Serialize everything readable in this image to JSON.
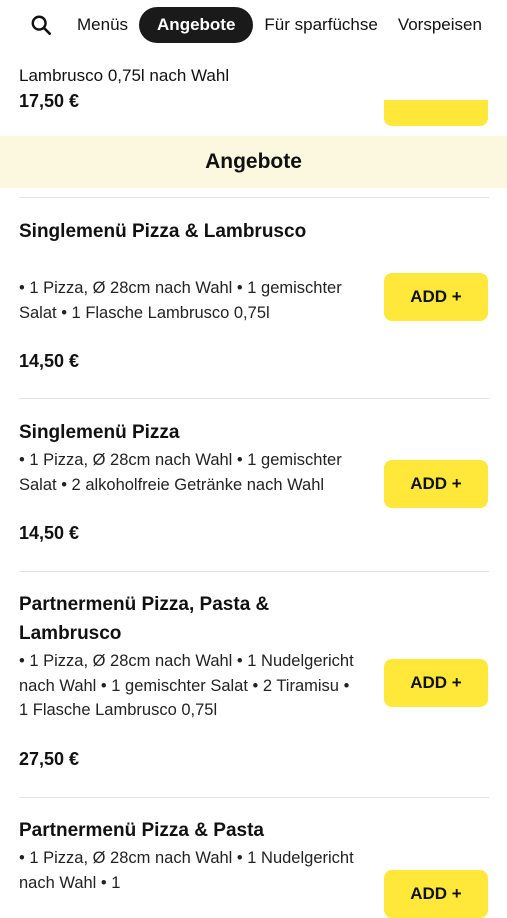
{
  "nav": {
    "tabs": [
      {
        "label": "Menüs",
        "active": false
      },
      {
        "label": "Angebote",
        "active": true
      },
      {
        "label": "Für sparfüchse",
        "active": false
      },
      {
        "label": "Vorspeisen",
        "active": false
      }
    ]
  },
  "previous_item": {
    "description": "Lambrusco 0,75l nach Wahl",
    "price": "17,50 €"
  },
  "section": {
    "title": "Angebote"
  },
  "items": [
    {
      "name": "Singlemenü Pizza & Lambrusco",
      "description": "• 1 Pizza, Ø 28cm nach Wahl • 1 gemischter Salat • 1 Flasche Lambrusco 0,75l",
      "price": "14,50 €",
      "add_label": "ADD +"
    },
    {
      "name": "Singlemenü Pizza",
      "description": "• 1 Pizza, Ø 28cm nach Wahl • 1 gemischter Salat • 2 alkoholfreie Getränke nach Wahl",
      "price": "14,50 €",
      "add_label": "ADD +"
    },
    {
      "name": "Partnermenü Pizza, Pasta & Lambrusco",
      "description": "• 1 Pizza, Ø 28cm nach Wahl • 1 Nudelgericht nach Wahl • 1 gemischter Salat • 2 Tiramisu • 1 Flasche Lambrusco 0,75l",
      "price": "27,50 €",
      "add_label": "ADD +"
    },
    {
      "name": "Partnermenü Pizza & Pasta",
      "description": "• 1 Pizza, Ø 28cm nach Wahl • 1 Nudelgericht nach Wahl • 1",
      "price": "",
      "add_label": "ADD +"
    }
  ],
  "colors": {
    "accent_yellow": "#ffe83a",
    "section_background": "#fcf8df",
    "active_tab": "#1a1a1a"
  }
}
